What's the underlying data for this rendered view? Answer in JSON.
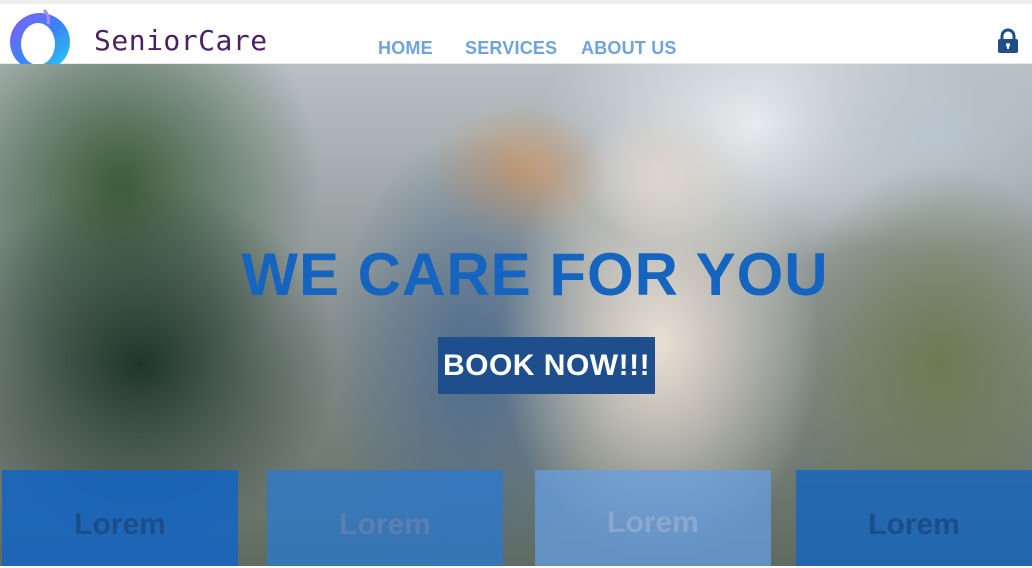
{
  "header": {
    "brand": "SeniorCare",
    "nav": [
      {
        "label": "HOME"
      },
      {
        "label": "SERVICES"
      },
      {
        "label": "ABOUT US"
      }
    ],
    "account_icon": "lock-icon"
  },
  "hero": {
    "title": "WE CARE FOR YOU",
    "cta_label": "BOOK NOW!!!"
  },
  "cards": [
    {
      "label": "Lorem"
    },
    {
      "label": "Lorem"
    },
    {
      "label": "Lorem"
    },
    {
      "label": "Lorem"
    }
  ],
  "colors": {
    "accent": "#1565c0",
    "nav": "#6fa3dc",
    "brand_text": "#4a1f63",
    "button": "#1e4f8c"
  }
}
